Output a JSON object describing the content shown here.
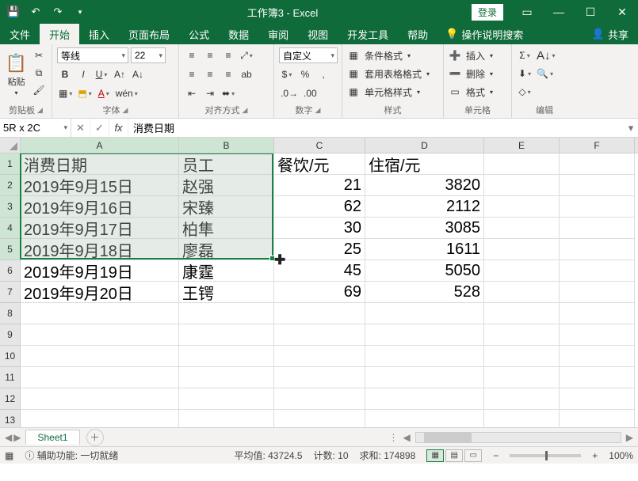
{
  "titlebar": {
    "title": "工作簿3 - Excel",
    "login": "登录"
  },
  "tabs": {
    "file": "文件",
    "home": "开始",
    "insert": "插入",
    "layout": "页面布局",
    "formulas": "公式",
    "data": "数据",
    "review": "审阅",
    "view": "视图",
    "dev": "开发工具",
    "help": "帮助",
    "tellme": "操作说明搜索",
    "share": "共享"
  },
  "ribbon": {
    "clipboard": {
      "paste": "粘贴",
      "label": "剪贴板"
    },
    "font": {
      "name": "等线",
      "size": "22",
      "label": "字体"
    },
    "align": {
      "wrap": "ab",
      "merge": "",
      "label": "对齐方式"
    },
    "number": {
      "format": "自定义",
      "label": "数字"
    },
    "styles": {
      "cond": "条件格式",
      "table": "套用表格格式",
      "cell": "单元格样式",
      "label": "样式"
    },
    "cells": {
      "insert": "插入",
      "delete": "删除",
      "format": "格式",
      "label": "单元格"
    },
    "editing": {
      "label": "编辑"
    }
  },
  "formula_bar": {
    "namebox": "5R x 2C",
    "content": "消费日期"
  },
  "columns": [
    "A",
    "B",
    "C",
    "D",
    "E",
    "F"
  ],
  "rows": [
    {
      "n": "1",
      "A": "消费日期",
      "B": "员工",
      "C": "餐饮/元",
      "D": "住宿/元"
    },
    {
      "n": "2",
      "A": "2019年9月15日",
      "B": "赵强",
      "C": "21",
      "D": "3820"
    },
    {
      "n": "3",
      "A": "2019年9月16日",
      "B": "宋臻",
      "C": "62",
      "D": "2112"
    },
    {
      "n": "4",
      "A": "2019年9月17日",
      "B": "柏隼",
      "C": "30",
      "D": "3085"
    },
    {
      "n": "5",
      "A": "2019年9月18日",
      "B": "廖磊",
      "C": "25",
      "D": "1611"
    },
    {
      "n": "6",
      "A": "2019年9月19日",
      "B": "康霆",
      "C": "45",
      "D": "5050"
    },
    {
      "n": "7",
      "A": "2019年9月20日",
      "B": "王锷",
      "C": "69",
      "D": "528"
    },
    {
      "n": "8"
    },
    {
      "n": "9"
    },
    {
      "n": "10"
    },
    {
      "n": "11"
    },
    {
      "n": "12"
    },
    {
      "n": "13"
    }
  ],
  "sheet": {
    "name": "Sheet1"
  },
  "status": {
    "acc": "辅助功能: 一切就绪",
    "avg": "平均值: 43724.5",
    "count": "计数: 10",
    "sum": "求和: 174898",
    "zoom": "100%"
  },
  "chart_data": {
    "type": "table",
    "title": "",
    "columns": [
      "消费日期",
      "员工",
      "餐饮/元",
      "住宿/元"
    ],
    "rows": [
      [
        "2019年9月15日",
        "赵强",
        21,
        3820
      ],
      [
        "2019年9月16日",
        "宋臻",
        62,
        2112
      ],
      [
        "2019年9月17日",
        "柏隼",
        30,
        3085
      ],
      [
        "2019年9月18日",
        "廖磊",
        25,
        1611
      ],
      [
        "2019年9月19日",
        "康霆",
        45,
        5050
      ],
      [
        "2019年9月20日",
        "王锷",
        69,
        528
      ]
    ]
  }
}
